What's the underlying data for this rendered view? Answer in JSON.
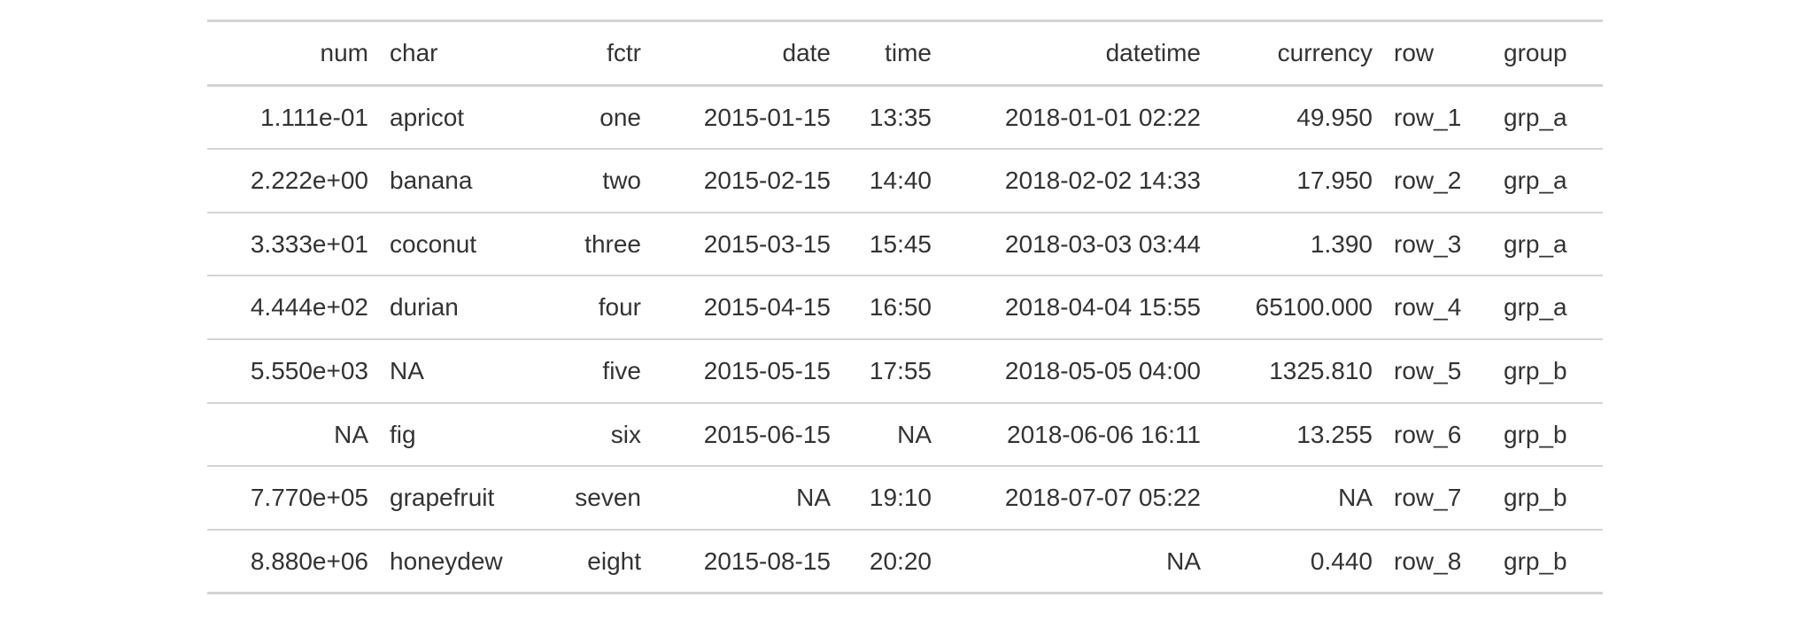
{
  "table": {
    "columns": [
      {
        "key": "num",
        "label": "num",
        "align": "right",
        "class": "c-num"
      },
      {
        "key": "char",
        "label": "char",
        "align": "left",
        "class": "c-char"
      },
      {
        "key": "fctr",
        "label": "fctr",
        "align": "right",
        "class": "c-fctr"
      },
      {
        "key": "date",
        "label": "date",
        "align": "right",
        "class": "c-date"
      },
      {
        "key": "time",
        "label": "time",
        "align": "right",
        "class": "c-time"
      },
      {
        "key": "datetime",
        "label": "datetime",
        "align": "right",
        "class": "c-datetime"
      },
      {
        "key": "currency",
        "label": "currency",
        "align": "right",
        "class": "c-currency"
      },
      {
        "key": "row",
        "label": "row",
        "align": "left",
        "class": "c-row"
      },
      {
        "key": "group",
        "label": "group",
        "align": "left",
        "class": "c-group"
      }
    ],
    "rows": [
      {
        "num": "1.111e-01",
        "char": "apricot",
        "fctr": "one",
        "date": "2015-01-15",
        "time": "13:35",
        "datetime": "2018-01-01 02:22",
        "currency": "49.950",
        "row": "row_1",
        "group": "grp_a"
      },
      {
        "num": "2.222e+00",
        "char": "banana",
        "fctr": "two",
        "date": "2015-02-15",
        "time": "14:40",
        "datetime": "2018-02-02 14:33",
        "currency": "17.950",
        "row": "row_2",
        "group": "grp_a"
      },
      {
        "num": "3.333e+01",
        "char": "coconut",
        "fctr": "three",
        "date": "2015-03-15",
        "time": "15:45",
        "datetime": "2018-03-03 03:44",
        "currency": "1.390",
        "row": "row_3",
        "group": "grp_a"
      },
      {
        "num": "4.444e+02",
        "char": "durian",
        "fctr": "four",
        "date": "2015-04-15",
        "time": "16:50",
        "datetime": "2018-04-04 15:55",
        "currency": "65100.000",
        "row": "row_4",
        "group": "grp_a"
      },
      {
        "num": "5.550e+03",
        "char": "NA",
        "fctr": "five",
        "date": "2015-05-15",
        "time": "17:55",
        "datetime": "2018-05-05 04:00",
        "currency": "1325.810",
        "row": "row_5",
        "group": "grp_b"
      },
      {
        "num": "NA",
        "char": "fig",
        "fctr": "six",
        "date": "2015-06-15",
        "time": "NA",
        "datetime": "2018-06-06 16:11",
        "currency": "13.255",
        "row": "row_6",
        "group": "grp_b"
      },
      {
        "num": "7.770e+05",
        "char": "grapefruit",
        "fctr": "seven",
        "date": "NA",
        "time": "19:10",
        "datetime": "2018-07-07 05:22",
        "currency": "NA",
        "row": "row_7",
        "group": "grp_b"
      },
      {
        "num": "8.880e+06",
        "char": "honeydew",
        "fctr": "eight",
        "date": "2015-08-15",
        "time": "20:20",
        "datetime": "NA",
        "currency": "0.440",
        "row": "row_8",
        "group": "grp_b"
      }
    ]
  }
}
